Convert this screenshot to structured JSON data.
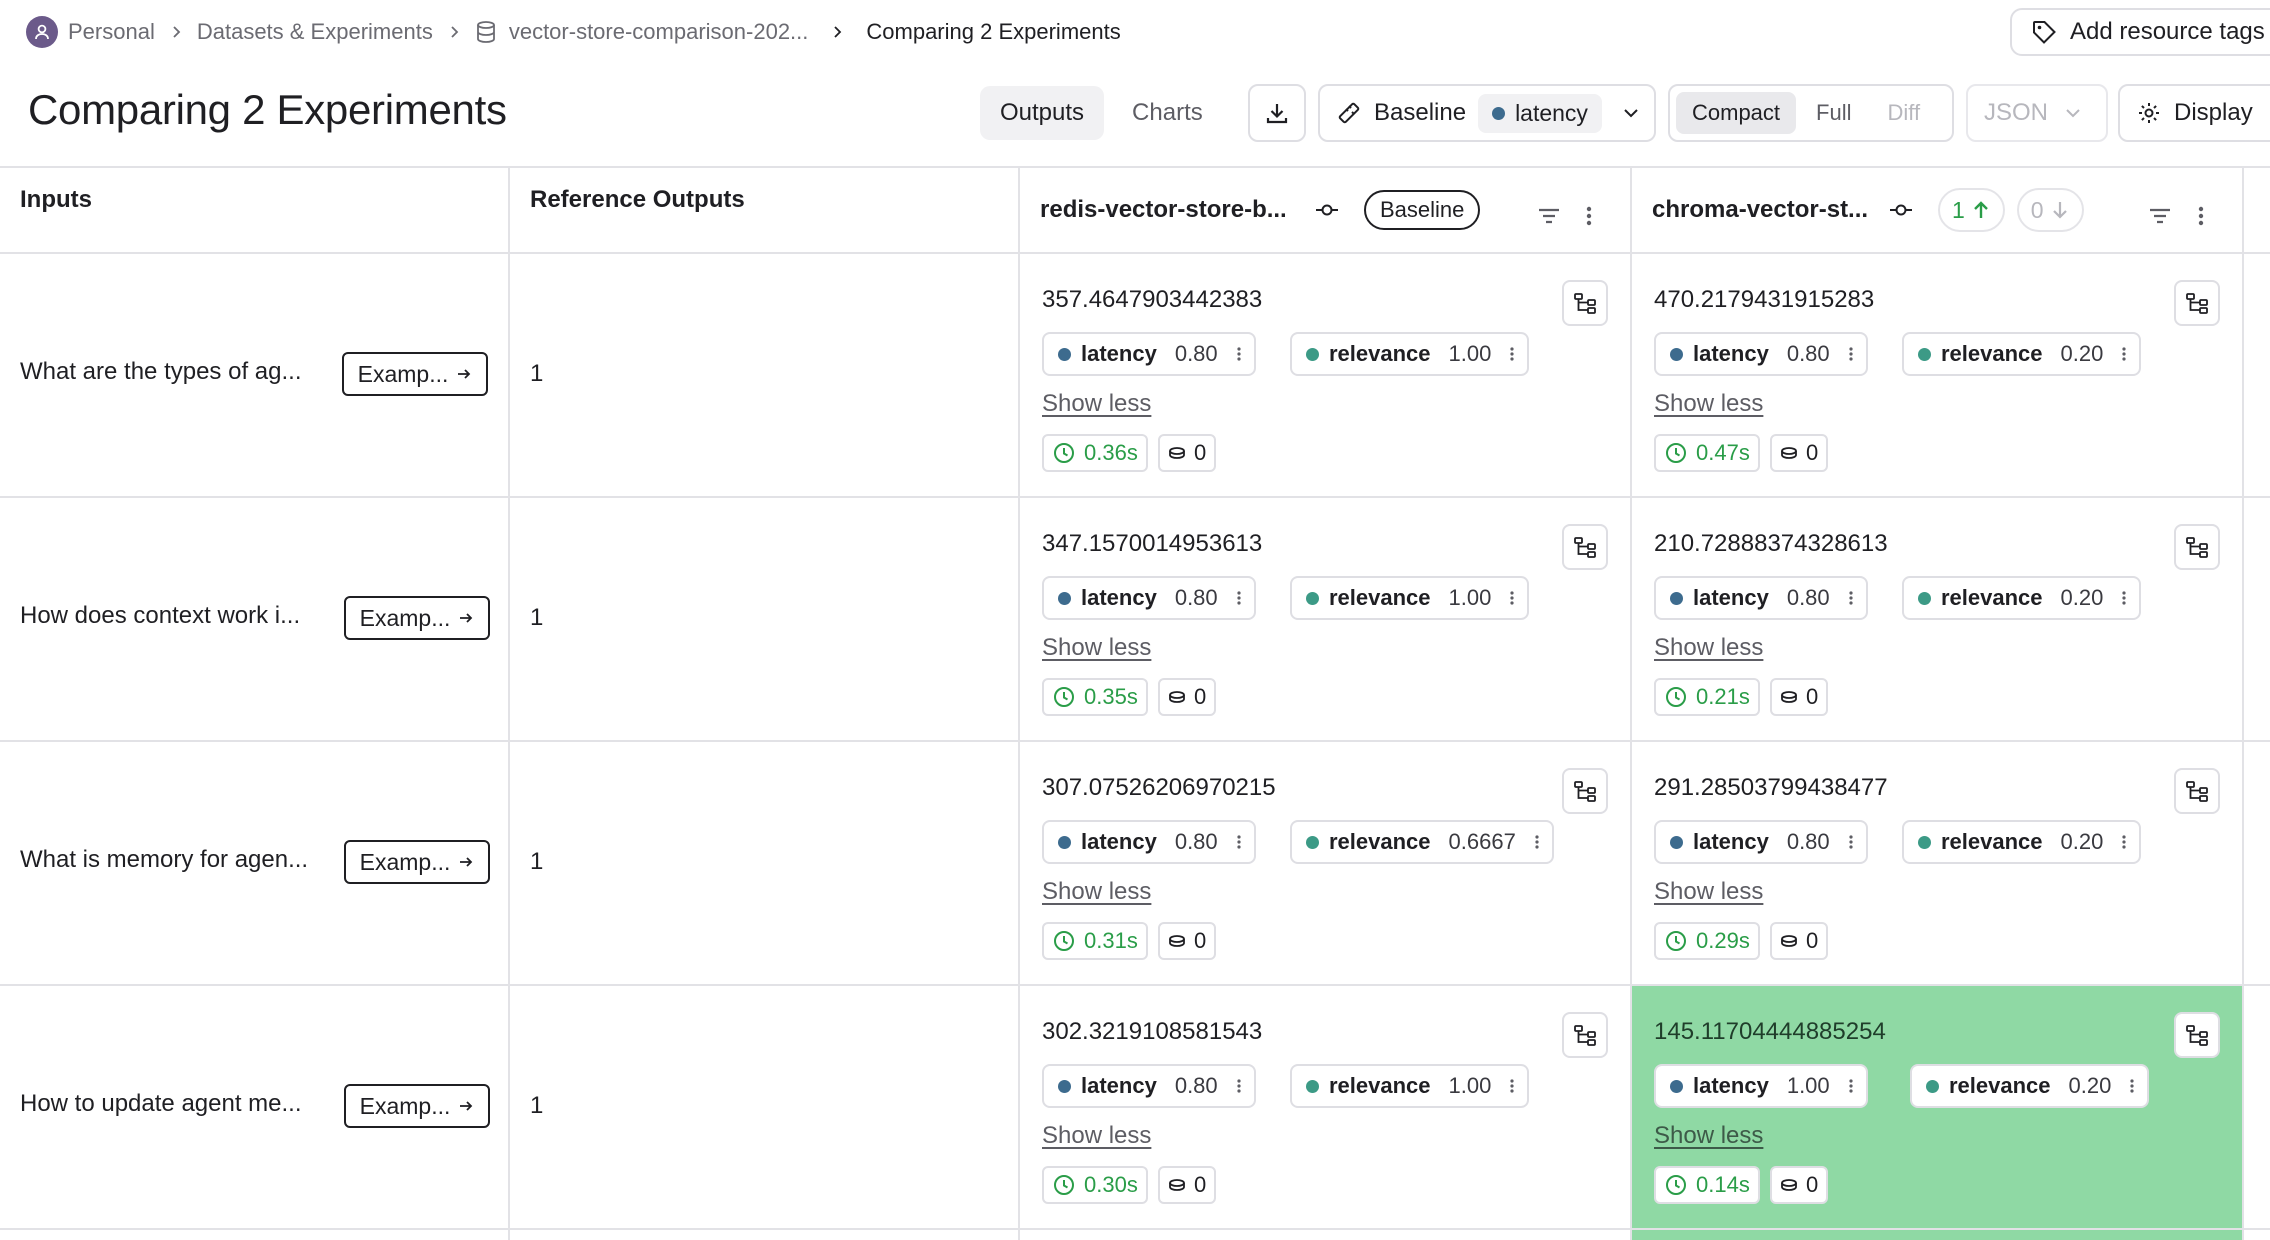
{
  "breadcrumb": {
    "items": [
      "Personal",
      "Datasets & Experiments",
      "vector-store-comparison-202...",
      "Comparing 2 Experiments"
    ]
  },
  "header": {
    "add_tags_label": "Add resource tags",
    "title": "Comparing 2 Experiments"
  },
  "toolbar": {
    "tabs": [
      "Outputs",
      "Charts"
    ],
    "active_tab": "Outputs",
    "baseline_label": "Baseline",
    "baseline_metric": "latency",
    "view_modes": [
      "Compact",
      "Full",
      "Diff"
    ],
    "active_view_mode": "Compact",
    "format_label": "JSON",
    "display_label": "Display"
  },
  "columns": {
    "inputs": "Inputs",
    "reference": "Reference Outputs",
    "experiments": [
      {
        "name": "redis-vector-store-b...",
        "badge": "Baseline"
      },
      {
        "name": "chroma-vector-st...",
        "improved": "1",
        "regressed": "0"
      }
    ]
  },
  "example_label": "Examp...",
  "show_less_label": "Show less",
  "rows": [
    {
      "input": "What are the types of ag...",
      "reference": "1",
      "outputs": [
        {
          "value": "357.4647903442383",
          "latency": "0.80",
          "relevance": "1.00",
          "time": "0.36s",
          "tokens": "0"
        },
        {
          "value": "470.2179431915283",
          "latency": "0.80",
          "relevance": "0.20",
          "time": "0.47s",
          "tokens": "0"
        }
      ]
    },
    {
      "input": "How does context work i...",
      "reference": "1",
      "outputs": [
        {
          "value": "347.1570014953613",
          "latency": "0.80",
          "relevance": "1.00",
          "time": "0.35s",
          "tokens": "0"
        },
        {
          "value": "210.72888374328613",
          "latency": "0.80",
          "relevance": "0.20",
          "time": "0.21s",
          "tokens": "0"
        }
      ]
    },
    {
      "input": "What is memory for agen...",
      "reference": "1",
      "outputs": [
        {
          "value": "307.07526206970215",
          "latency": "0.80",
          "relevance": "0.6667",
          "time": "0.31s",
          "tokens": "0"
        },
        {
          "value": "291.28503799438477",
          "latency": "0.80",
          "relevance": "0.20",
          "time": "0.29s",
          "tokens": "0"
        }
      ]
    },
    {
      "input": "How to update agent me...",
      "reference": "1",
      "outputs": [
        {
          "value": "302.3219108581543",
          "latency": "0.80",
          "relevance": "1.00",
          "time": "0.30s",
          "tokens": "0"
        },
        {
          "value": "145.11704444885254",
          "latency": "1.00",
          "relevance": "0.20",
          "time": "0.14s",
          "tokens": "0",
          "improved": true
        }
      ]
    }
  ],
  "colors": {
    "improved_cell": "#8fd9a4",
    "latency_dot": "#3d6b8e",
    "relevance_dot": "#3c9a86",
    "positive_text": "#2a9d48"
  },
  "feedback_keys": {
    "latency": "latency",
    "relevance": "relevance"
  }
}
